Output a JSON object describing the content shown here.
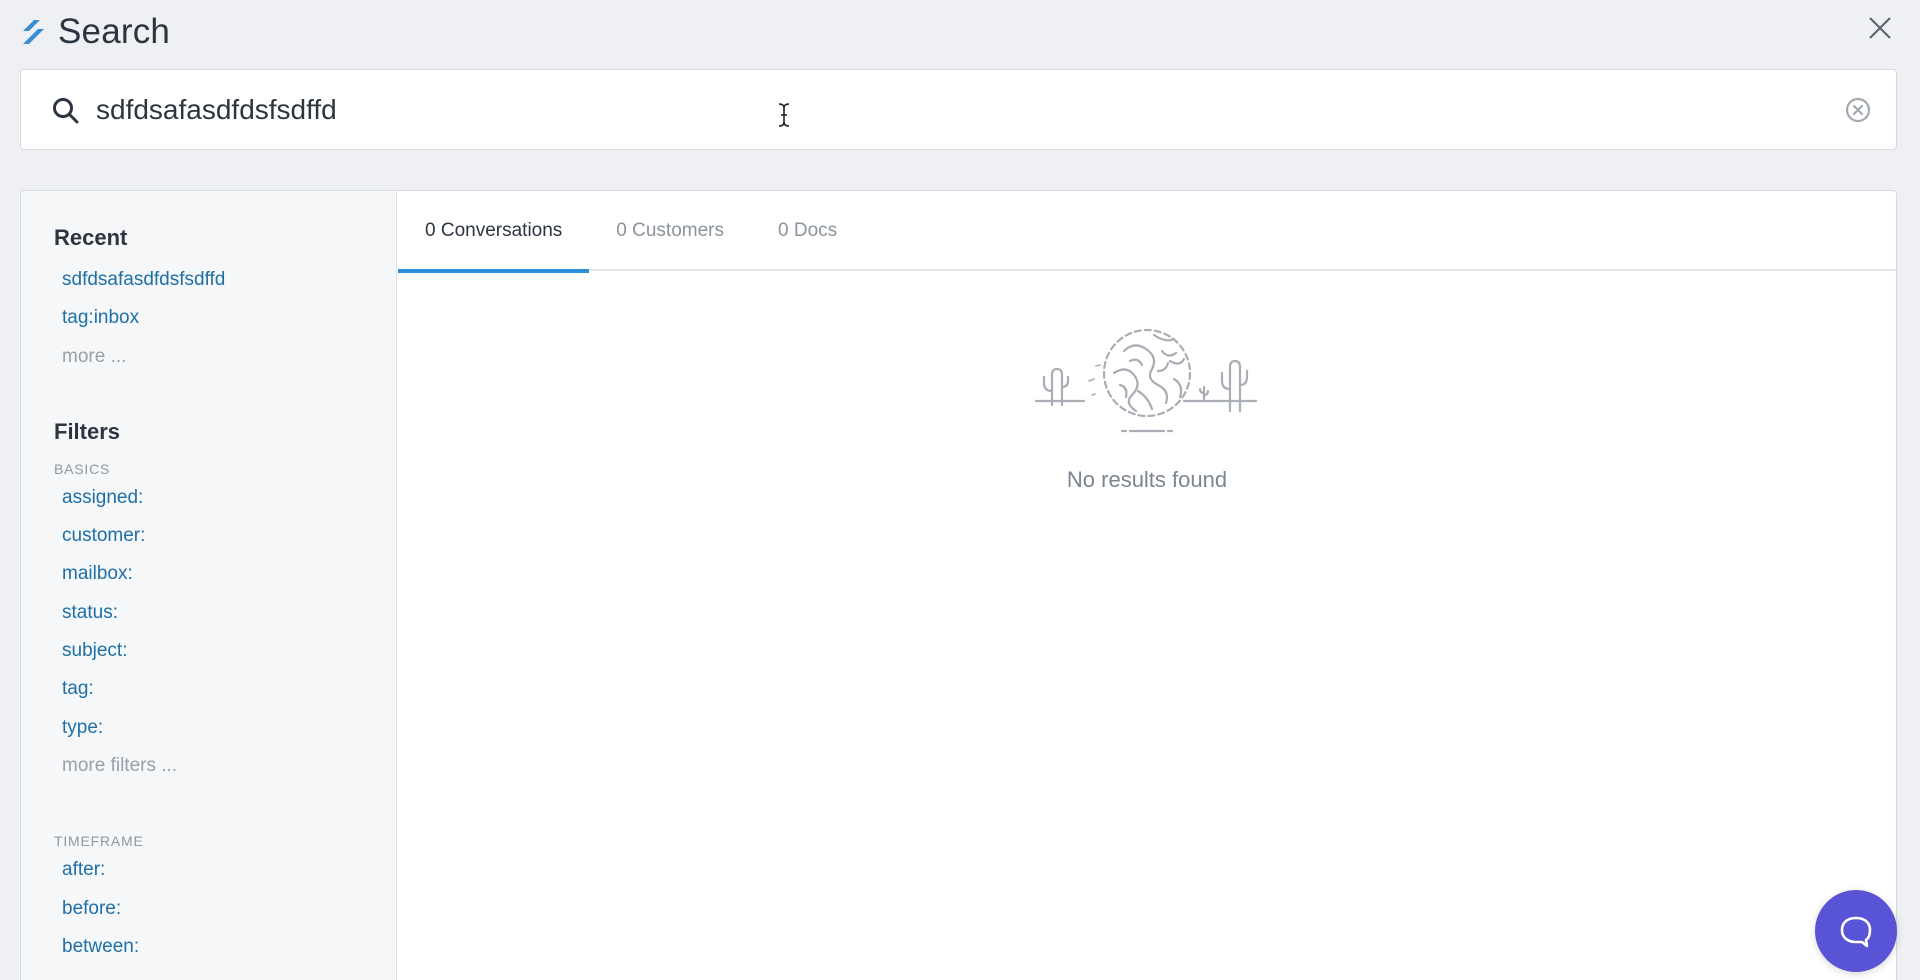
{
  "header": {
    "title": "Search",
    "logo_icon": "helpscout-logo-icon",
    "close_icon": "close-icon"
  },
  "search": {
    "value": "sdfdsafasdfdsfsdffd",
    "placeholder": "",
    "search_icon": "search-icon",
    "clear_icon": "clear-circle-icon"
  },
  "sidebar": {
    "recent_heading": "Recent",
    "recent_items": [
      {
        "label": "sdfdsafasdfdsfsdffd"
      },
      {
        "label": "tag:inbox"
      }
    ],
    "recent_more": "more ...",
    "filters_heading": "Filters",
    "basics_heading": "BASICS",
    "basics_items": [
      {
        "label": "assigned:"
      },
      {
        "label": "customer:"
      },
      {
        "label": "mailbox:"
      },
      {
        "label": "status:"
      },
      {
        "label": "subject:"
      },
      {
        "label": "tag:"
      },
      {
        "label": "type:"
      }
    ],
    "basics_more": "more filters ...",
    "timeframe_heading": "TIMEFRAME",
    "timeframe_items": [
      {
        "label": "after:"
      },
      {
        "label": "before:"
      },
      {
        "label": "between:"
      }
    ]
  },
  "tabs": [
    {
      "label": "0 Conversations",
      "active": true
    },
    {
      "label": "0 Customers",
      "active": false
    },
    {
      "label": "0 Docs",
      "active": false
    }
  ],
  "results": {
    "empty_message": "No results found",
    "illustration": "tumbleweed-desert-illustration"
  },
  "chat_button": {
    "icon": "chat-bubble-icon",
    "color": "#5954d6"
  },
  "colors": {
    "accent": "#2c8fd9",
    "link": "#1e6fa8",
    "background": "#eef0f4"
  }
}
